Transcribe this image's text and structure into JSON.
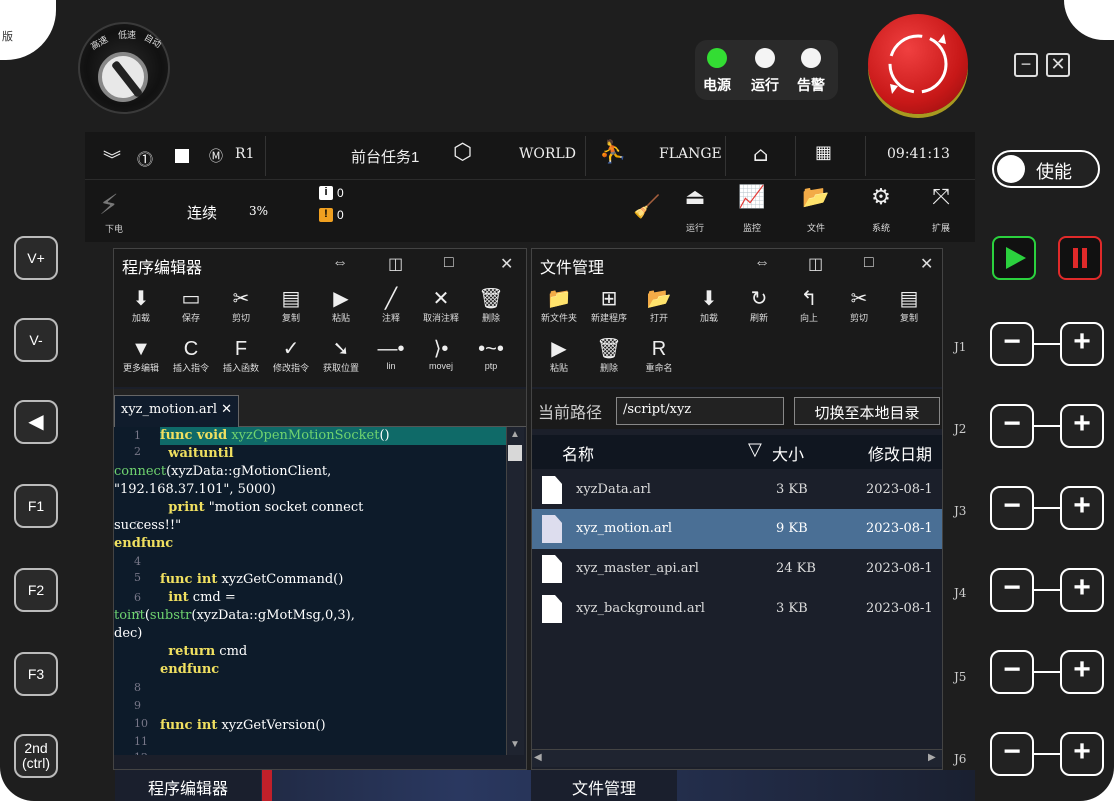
{
  "corner": "版",
  "mode_knob": {
    "label_left": "高速",
    "label_mid": "低速",
    "label_right": "自动"
  },
  "lights": [
    {
      "label": "电源",
      "color": "#33dd33"
    },
    {
      "label": "运行",
      "color": "#f4f4f4"
    },
    {
      "label": "告警",
      "color": "#f4f4f4"
    }
  ],
  "window": {
    "minimize": "−",
    "close": "✕"
  },
  "enable": {
    "label": "使能"
  },
  "status": {
    "robot": "R1",
    "task": "前台任务1",
    "coord": "WORLD",
    "tool": "FLANGE",
    "time": "09:41:13"
  },
  "toolbar2": {
    "power_state": "下电",
    "mode": "连续",
    "speed": "3%",
    "info_count": "0",
    "warn_count": "0",
    "buttons": [
      "运行",
      "监控",
      "文件",
      "系统",
      "扩展"
    ]
  },
  "left_buttons": [
    "V+",
    "V-",
    "◀",
    "F1",
    "F2",
    "F3",
    "2nd\n(ctrl)"
  ],
  "joints": [
    "J1",
    "J2",
    "J3",
    "J4",
    "J5",
    "J6"
  ],
  "editor": {
    "title": "程序编辑器",
    "controls": [
      "⇔",
      "◫",
      "□",
      "✕"
    ],
    "tools_row1": [
      "加载",
      "保存",
      "剪切",
      "复制",
      "粘贴",
      "注释",
      "取消注释",
      "删除"
    ],
    "tools_row2": [
      "更多编辑",
      "插入指令",
      "插入函数",
      "修改指令",
      "获取位置",
      "lin",
      "movej",
      "ptp"
    ],
    "tab": "xyz_motion.arl",
    "line_numbers": [
      "1",
      "2",
      "",
      "",
      "3",
      "",
      "4",
      "5",
      "6",
      "7",
      "",
      "",
      "8",
      "9",
      "10",
      "11",
      "12"
    ]
  },
  "files": {
    "title": "文件管理",
    "controls": [
      "⇔",
      "◫",
      "□",
      "✕"
    ],
    "tools_row1": [
      "新文件夹",
      "新建程序",
      "打开",
      "加载",
      "刷新",
      "向上",
      "剪切",
      "复制"
    ],
    "tools_row2": [
      "粘贴",
      "删除",
      "重命名"
    ],
    "path_label": "当前路径",
    "path": "/script/xyz",
    "switch_button": "切换至本地目录",
    "columns": {
      "name": "名称",
      "size": "大小",
      "date": "修改日期"
    },
    "rows": [
      {
        "name": "xyzData.arl",
        "size": "3 KB",
        "date": "2023-08-1"
      },
      {
        "name": "xyz_motion.arl",
        "size": "9 KB",
        "date": "2023-08-1"
      },
      {
        "name": "xyz_master_api.arl",
        "size": "24 KB",
        "date": "2023-08-1"
      },
      {
        "name": "xyz_background.arl",
        "size": "3 KB",
        "date": "2023-08-1"
      }
    ],
    "selected_index": 1
  },
  "bottom_tabs": [
    "程序编辑器",
    "文件管理"
  ]
}
